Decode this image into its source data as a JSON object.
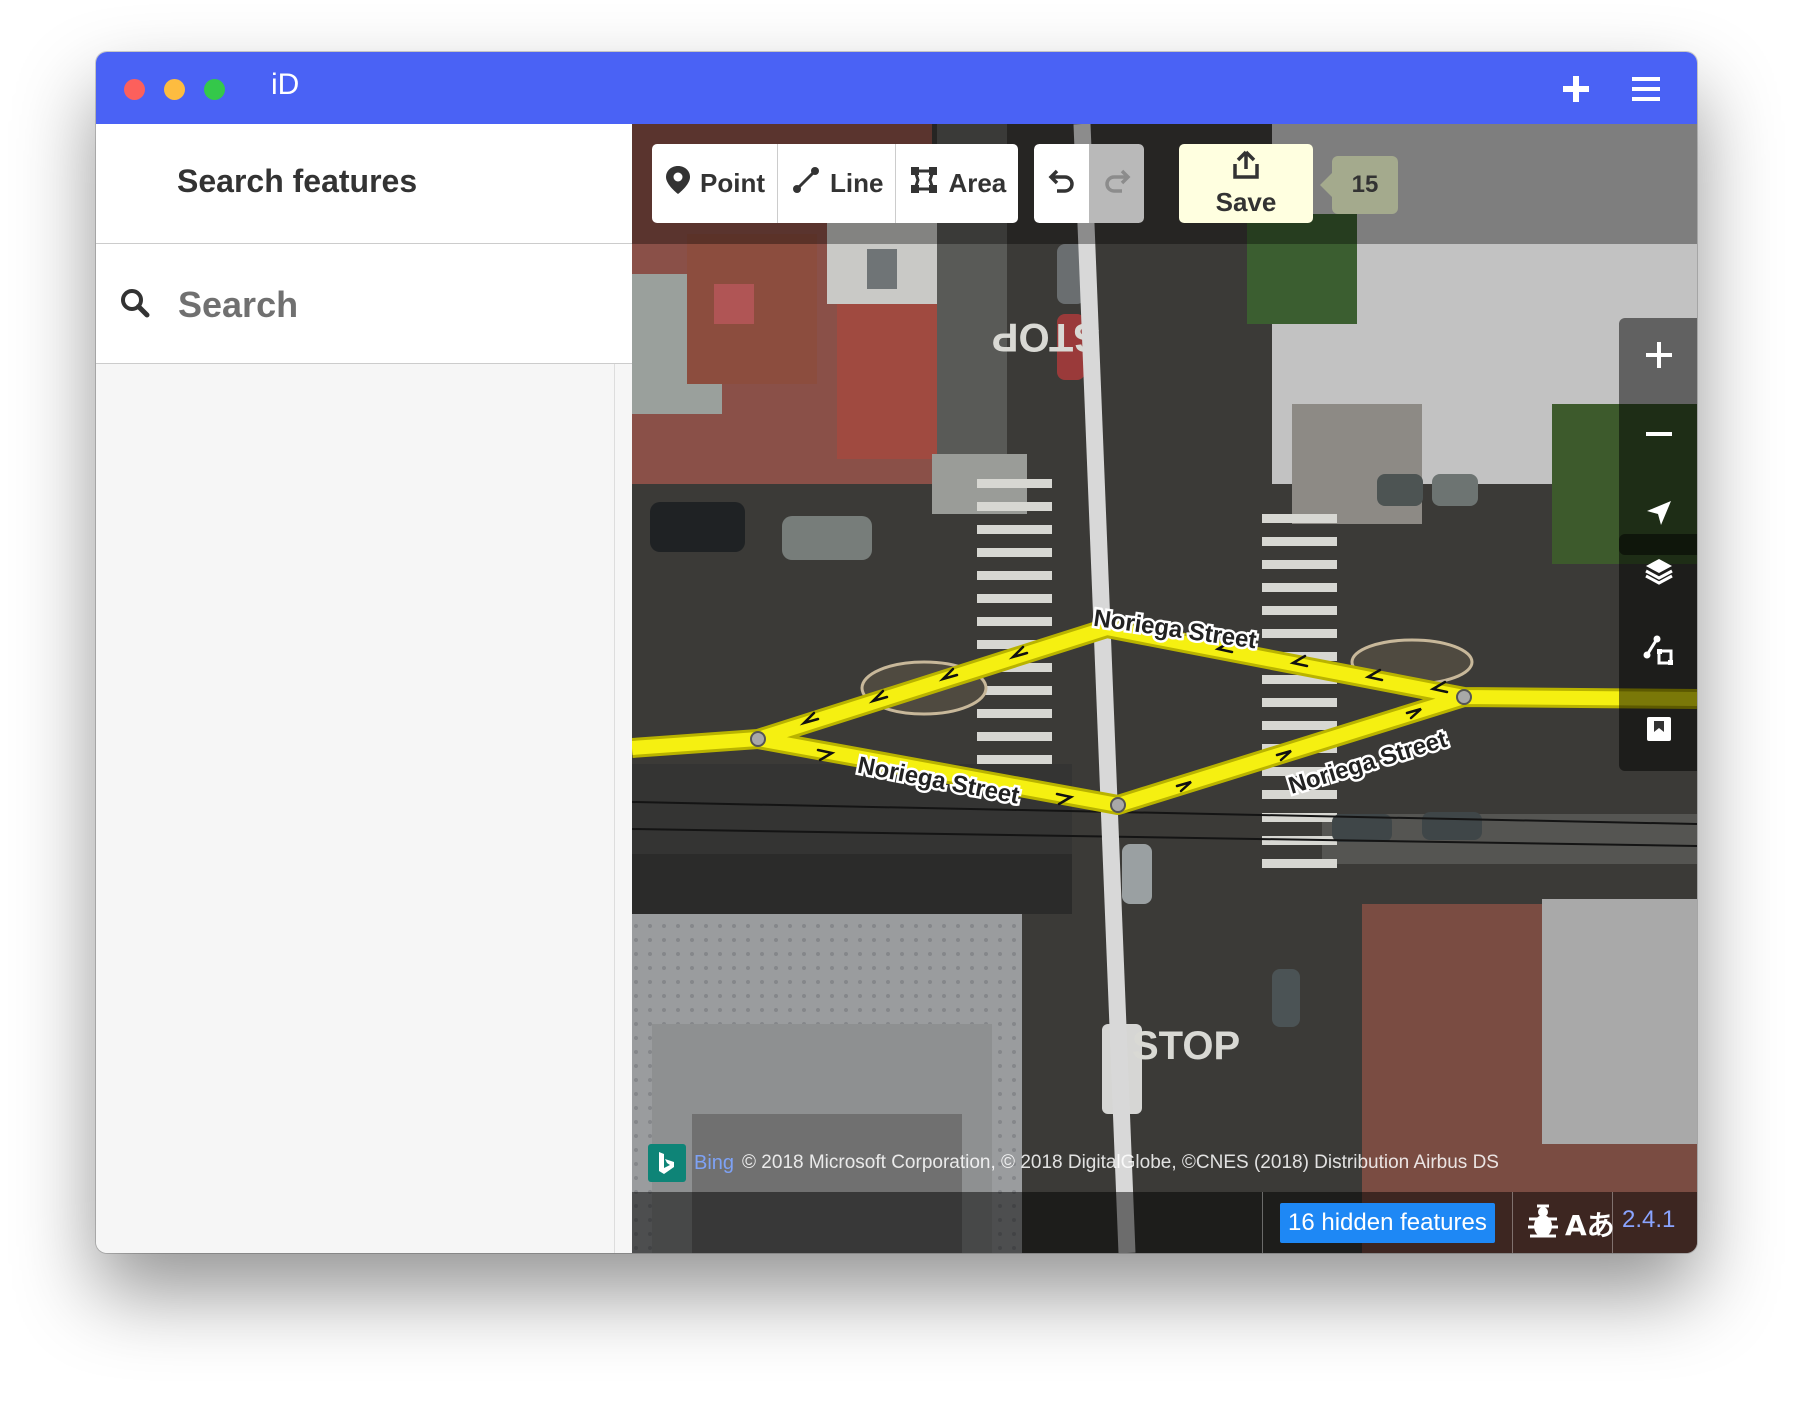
{
  "window": {
    "title": "iD"
  },
  "titlebar": {
    "icons": [
      "plus-icon",
      "menu-icon"
    ]
  },
  "sidebar": {
    "title": "Search features",
    "search": {
      "placeholder": "Search",
      "value": ""
    }
  },
  "toolbar": {
    "modes": [
      {
        "label": "Point",
        "icon": "point-icon"
      },
      {
        "label": "Line",
        "icon": "line-icon"
      },
      {
        "label": "Area",
        "icon": "area-icon"
      }
    ],
    "undo_icon": "undo-icon",
    "redo_icon": "redo-icon",
    "save_label": "Save",
    "save_count": "15"
  },
  "map": {
    "street_labels": [
      "Noriega Street",
      "Noriega Street",
      "Noriega Street"
    ],
    "road_markings": [
      "STOP",
      "STOP"
    ],
    "controls": [
      "zoom-in-icon",
      "zoom-out-icon",
      "geolocate-icon",
      "layers-icon",
      "map-data-icon",
      "help-icon"
    ],
    "colors": {
      "highlight_way": "#f5f011",
      "accent": "#4a62f5",
      "save_bg": "#ffffe0"
    }
  },
  "attribution": {
    "provider": "Bing",
    "text": "© 2018 Microsoft Corporation, © 2018 DigitalGlobe, ©CNES (2018) Distribution Airbus DS"
  },
  "footer": {
    "hidden_features": "16 hidden features",
    "issue_icon": "bug-icon",
    "translate_icon": "translate-icon",
    "translate_label": "Aあ",
    "version": "2.4.1"
  }
}
